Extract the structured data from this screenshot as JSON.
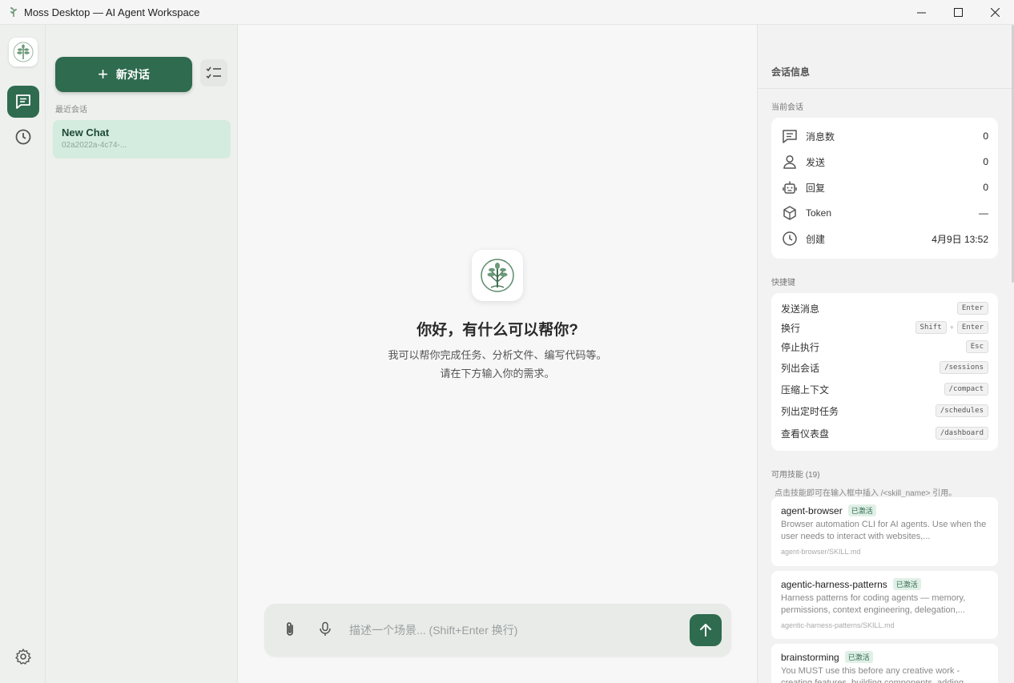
{
  "window": {
    "title": "Moss Desktop — AI Agent Workspace"
  },
  "sidebar": {
    "new_chat_label": "新对话",
    "recent_label": "最近会话",
    "chats": [
      {
        "title": "New Chat",
        "subtitle": "02a2022a-4c74-..."
      }
    ]
  },
  "main": {
    "greeting": "你好，有什么可以帮你?",
    "sub_line1": "我可以帮你完成任务、分析文件、编写代码等。",
    "sub_line2": "请在下方输入你的需求。",
    "input_placeholder": "描述一个场景... (Shift+Enter 换行)"
  },
  "info_panel": {
    "title": "会话信息",
    "current_label": "当前会话",
    "rows": [
      {
        "icon": "message-icon",
        "label": "消息数",
        "value": "0"
      },
      {
        "icon": "user-icon",
        "label": "发送",
        "value": "0"
      },
      {
        "icon": "robot-icon",
        "label": "回复",
        "value": "0"
      },
      {
        "icon": "cube-icon",
        "label": "Token",
        "value": "—"
      },
      {
        "icon": "clock-icon",
        "label": "创建",
        "value": "4月9日 13:52"
      }
    ],
    "shortcuts_label": "快捷键",
    "shortcuts": [
      {
        "label": "发送消息",
        "keys": [
          "Enter"
        ]
      },
      {
        "label": "换行",
        "keys": [
          "Shift",
          "Enter"
        ]
      },
      {
        "label": "停止执行",
        "keys": [
          "Esc"
        ]
      },
      {
        "label": "列出会话",
        "keys": [
          "/sessions"
        ]
      },
      {
        "label": "压缩上下文",
        "keys": [
          "/compact"
        ]
      },
      {
        "label": "列出定时任务",
        "keys": [
          "/schedules"
        ]
      },
      {
        "label": "查看仪表盘",
        "keys": [
          "/dashboard"
        ]
      }
    ],
    "skills_label": "可用技能 (19)",
    "skills_hint": "点击技能即可在输入框中插入 /<skill_name> 引用。",
    "skills": [
      {
        "name": "agent-browser",
        "badge": "已激活",
        "desc": "Browser automation CLI for AI agents. Use when the user needs to interact with websites,...",
        "path": "agent-browser/SKILL.md"
      },
      {
        "name": "agentic-harness-patterns",
        "badge": "已激活",
        "desc": "Harness patterns for coding agents — memory, permissions, context engineering, delegation,...",
        "path": "agentic-harness-patterns/SKILL.md"
      },
      {
        "name": "brainstorming",
        "badge": "已激活",
        "desc": "You MUST use this before any creative work - creating features, building components, adding...",
        "path": ""
      }
    ]
  },
  "colors": {
    "accent": "#2f6b4f",
    "active_chat": "#d4ecdf",
    "badge_bg": "#e1f0e7"
  }
}
